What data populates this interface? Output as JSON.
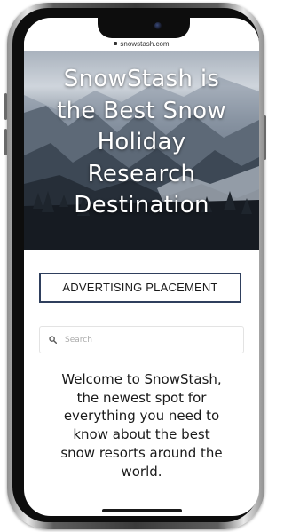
{
  "browser": {
    "url": "snowstash.com"
  },
  "hero": {
    "title_lines": [
      "SnowStash is",
      "the Best Snow",
      "Holiday",
      "Research",
      "Destination"
    ]
  },
  "ad": {
    "label": "ADVERTISING PLACEMENT"
  },
  "search": {
    "placeholder": "Search",
    "icon": "search-icon"
  },
  "welcome": {
    "lines": [
      "Welcome to SnowStash,",
      "the newest spot for",
      "everything you need to",
      "know about the best",
      "snow resorts around the",
      "world."
    ]
  },
  "colors": {
    "ad_border": "#2f3f5d",
    "frame": "#0d0d0d",
    "text": "#1a1a1a"
  }
}
